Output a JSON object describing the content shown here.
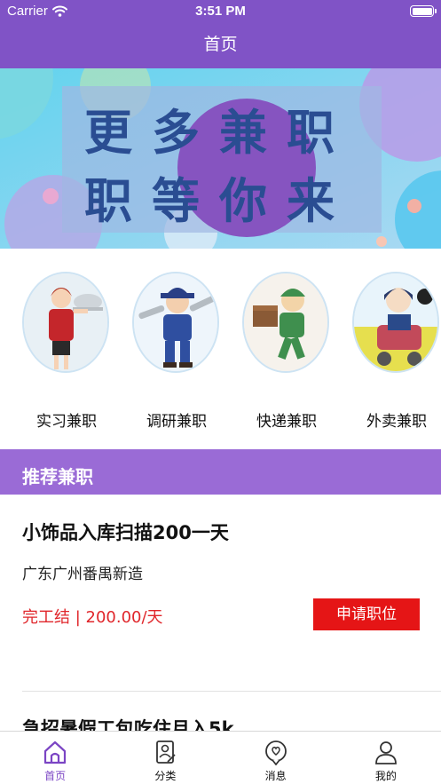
{
  "status_bar": {
    "carrier": "Carrier",
    "time": "3:51 PM"
  },
  "nav": {
    "title": "首页"
  },
  "banner": {
    "line1": "更多兼职",
    "line2": "职等你来"
  },
  "categories": [
    {
      "label": "实习兼职",
      "icon": "waitress-icon"
    },
    {
      "label": "调研兼职",
      "icon": "mechanic-icon"
    },
    {
      "label": "快递兼职",
      "icon": "courier-icon"
    },
    {
      "label": "外卖兼职",
      "icon": "delivery-rider-icon"
    }
  ],
  "section": {
    "title": "推荐兼职"
  },
  "jobs": [
    {
      "title": "小饰品入库扫描200一天",
      "location": "广东广州番禺新造",
      "salary": "完工结 | 200.00/天",
      "apply_label": "申请职位"
    },
    {
      "title": "急招暑假工包吃住月入5k"
    }
  ],
  "tabs": [
    {
      "label": "首页",
      "icon": "home-icon",
      "active": true
    },
    {
      "label": "分类",
      "icon": "category-icon",
      "active": false
    },
    {
      "label": "消息",
      "icon": "message-icon",
      "active": false
    },
    {
      "label": "我的",
      "icon": "profile-icon",
      "active": false
    }
  ],
  "colors": {
    "brand": "#8053c6",
    "section": "#9a6bd6",
    "accent_red": "#e51516",
    "salary_red": "#e0262b"
  }
}
